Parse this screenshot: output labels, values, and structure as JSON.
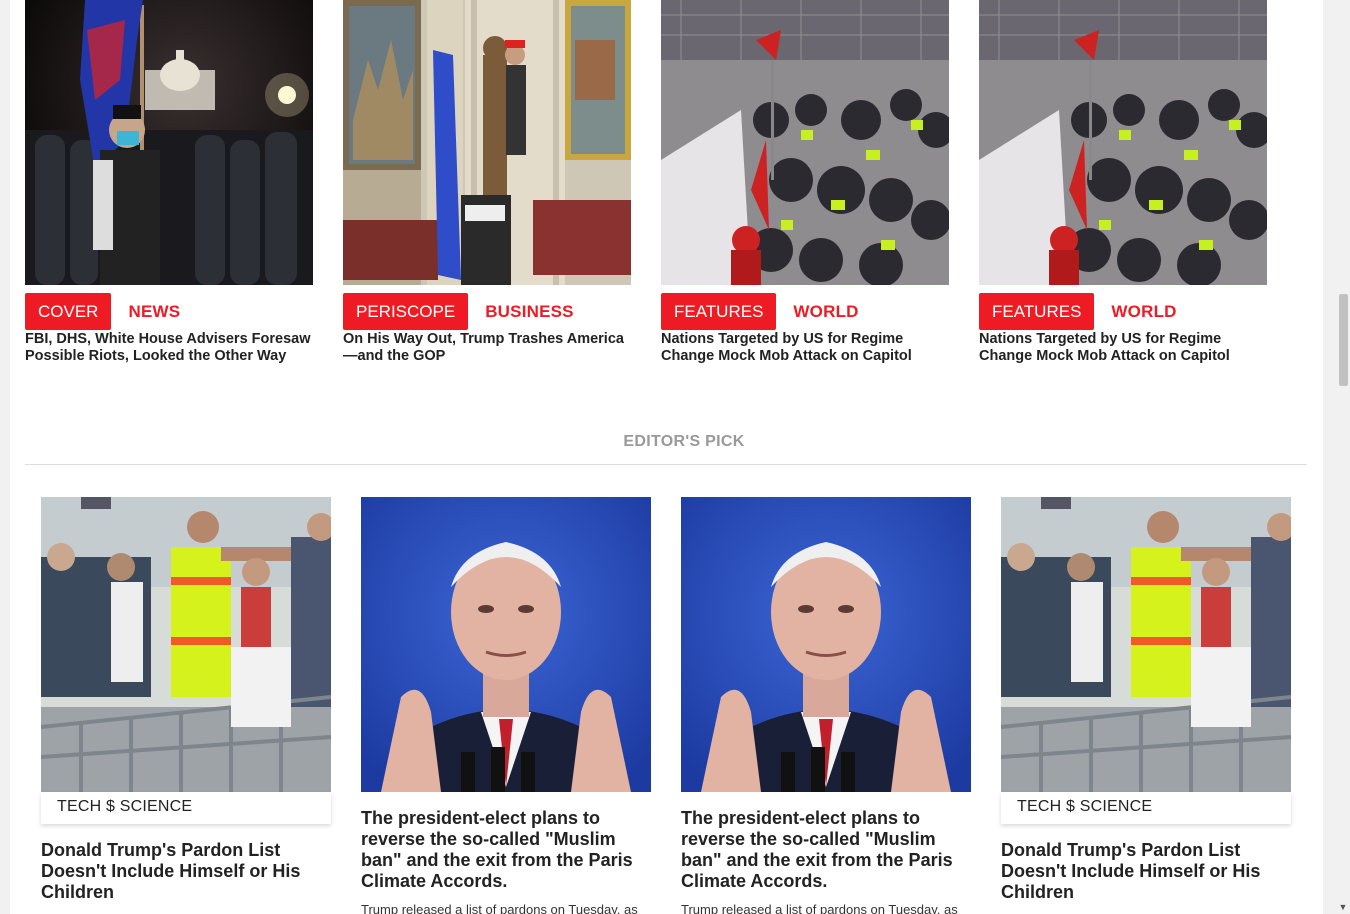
{
  "top_stories": [
    {
      "tag_primary": "COVER",
      "tag_secondary": "NEWS",
      "title": "FBI, DHS, White House Advisers Foresaw Possible Riots, Looked the Other Way"
    },
    {
      "tag_primary": "PERISCOPE",
      "tag_secondary": "BUSINESS",
      "title": "On His Way Out, Trump Trashes America—and the GOP"
    },
    {
      "tag_primary": "FEATURES",
      "tag_secondary": "WORLD",
      "title": "Nations Targeted by US for Regime Change Mock Mob Attack on Capitol"
    },
    {
      "tag_primary": "FEATURES",
      "tag_secondary": "WORLD",
      "title": "Nations Targeted by US for Regime Change Mock Mob Attack on Capitol"
    }
  ],
  "editors_pick": {
    "heading": "EDITOR'S PICK",
    "items": [
      {
        "category": "TECH $ SCIENCE",
        "title": "Donald Trump's Pardon List Doesn't Include Himself or His Children"
      },
      {
        "title": "The president-elect plans to reverse the so-called \"Muslim ban\" and the exit from the Paris Climate Accords.",
        "excerpt": "Trump released a list of pardons on Tuesday, as"
      },
      {
        "title": "The president-elect plans to reverse the so-called \"Muslim ban\" and the exit from the Paris Climate Accords.",
        "excerpt": "Trump released a list of pardons on Tuesday, as"
      },
      {
        "category": "TECH $ SCIENCE",
        "title": "Donald Trump's Pardon List Doesn't Include Himself or His Children"
      }
    ]
  },
  "colors": {
    "accent": "#ee1b24",
    "heading_grey": "#999999"
  }
}
